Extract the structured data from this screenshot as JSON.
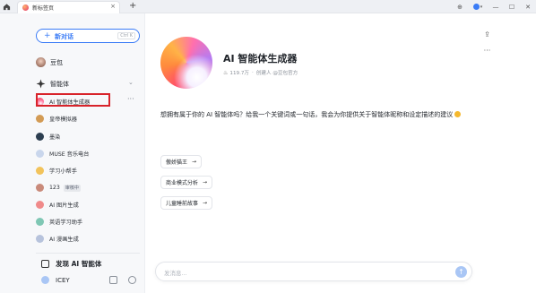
{
  "titlebar": {
    "tab_title": "新标签页",
    "tab_close": "×",
    "new_tab": "+",
    "controls": {
      "pin": "⊕",
      "minimize": "—",
      "maximize": "☐",
      "close": "✕"
    }
  },
  "sidebar": {
    "new_chat_label": "新对话",
    "new_chat_plus": "+",
    "new_chat_shortcut": "Ctrl K",
    "doubao": "豆包",
    "agents_section": "智能体",
    "agents_toggle": "⌄",
    "more": "···",
    "items": [
      {
        "label": "AI 智能体生成器",
        "color": "#ff5a7a"
      },
      {
        "label": "皇帝模拟器",
        "color": "#d39b54"
      },
      {
        "label": "墨染",
        "color": "#2c3e50"
      },
      {
        "label": "MUSE 音乐电台",
        "color": "#c9d6ec"
      },
      {
        "label": "学习小帮手",
        "color": "#f2c35b"
      },
      {
        "label": "123",
        "badge": "审核中",
        "color": "#c98a7a"
      },
      {
        "label": "AI 图片生成",
        "color": "#f08a8a"
      },
      {
        "label": "英语学习助手",
        "color": "#7fc7b4"
      },
      {
        "label": "AI 漫画生成",
        "color": "#b7c3dc"
      }
    ],
    "discover": "发现 AI 智能体",
    "user_name": "ICEY"
  },
  "main": {
    "bot_name": "AI 智能体生成器",
    "bot_stats": "119.7万",
    "bot_creator": "创建人 @豆包官方",
    "intro": "想拥有属于你的 AI 智能体吗？给我一个关键词或一句话，我会为你提供关于智能体昵称和设定描述的建议",
    "suggestions": [
      "傲娇猫王",
      "商业模式分析",
      "儿童睡前故事"
    ],
    "arrow": "→",
    "composer_placeholder": "发消息...",
    "send_icon": "↑",
    "share_icon": "⇪",
    "more_icon": "···"
  },
  "colors": {
    "accent": "#3b7cf6",
    "highlight": "#d8232a"
  }
}
